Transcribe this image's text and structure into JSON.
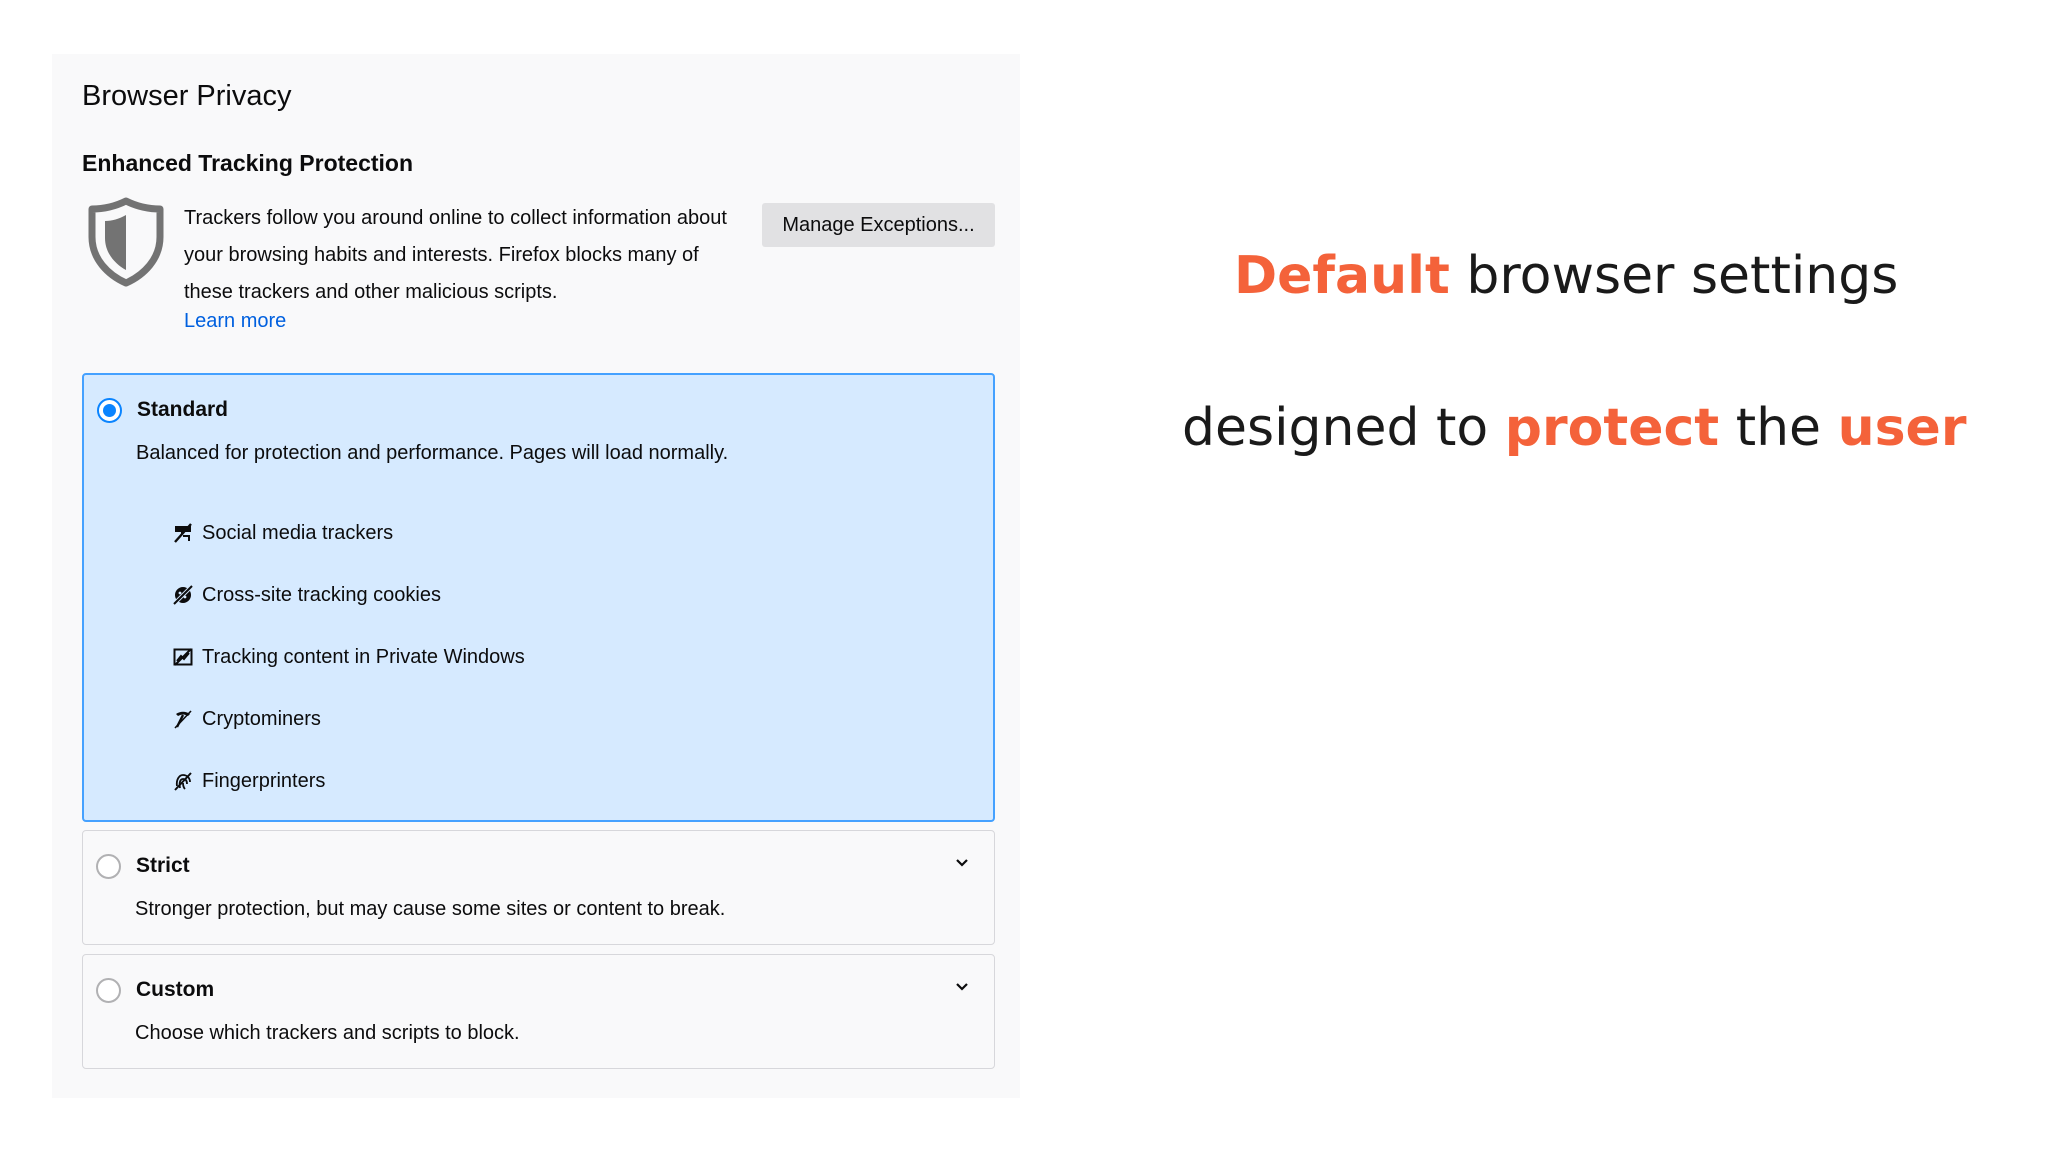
{
  "settings": {
    "page_title": "Browser Privacy",
    "section_title": "Enhanced Tracking Protection",
    "intro_text": "Trackers follow you around online to collect information about your browsing habits and interests. Firefox blocks many of these trackers and other malicious scripts.",
    "learn_more": "Learn more",
    "manage_exceptions": "Manage Exceptions...",
    "options": {
      "standard": {
        "label": "Standard",
        "description": "Balanced for protection and performance. Pages will load normally.",
        "selected": true,
        "trackers": [
          {
            "label": "Social media trackers",
            "icon": "social-tracker-icon"
          },
          {
            "label": "Cross-site tracking cookies",
            "icon": "cookie-icon"
          },
          {
            "label": "Tracking content in Private Windows",
            "icon": "tracking-content-icon"
          },
          {
            "label": "Cryptominers",
            "icon": "cryptominer-icon"
          },
          {
            "label": "Fingerprinters",
            "icon": "fingerprint-icon"
          }
        ]
      },
      "strict": {
        "label": "Strict",
        "description": "Stronger protection, but may cause some sites or content to break.",
        "selected": false
      },
      "custom": {
        "label": "Custom",
        "description": "Choose which trackers and scripts to block.",
        "selected": false
      }
    }
  },
  "slide": {
    "line1": {
      "highlight": "Default",
      "rest": " browser settings"
    },
    "line2": {
      "part1": "designed to ",
      "highlight1": "protect",
      "part2": " the ",
      "highlight2": "user"
    }
  },
  "colors": {
    "accent": "#f4623a",
    "selected_bg": "#d6eaff",
    "selected_border": "#45a1ff",
    "radio_blue": "#0a84ff",
    "link": "#0060df"
  }
}
